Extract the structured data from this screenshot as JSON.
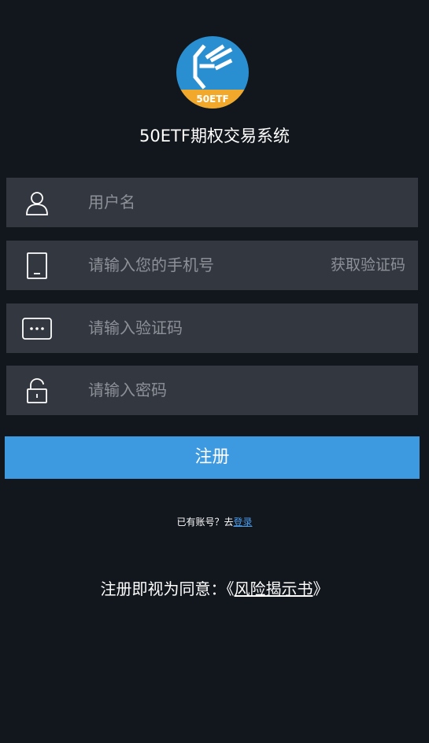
{
  "app": {
    "title": "50ETF期权交易系统",
    "logo_text": "50ETF",
    "logo_colors": {
      "circle": "#2a8fd0",
      "band": "#f2a82a"
    }
  },
  "form": {
    "username": {
      "icon": "user-icon",
      "placeholder": "用户名"
    },
    "phone": {
      "icon": "phone-icon",
      "placeholder": "请输入您的手机号",
      "get_code_label": "获取验证码"
    },
    "code": {
      "icon": "message-dots-icon",
      "placeholder": "请输入验证码"
    },
    "password": {
      "icon": "lock-icon",
      "placeholder": "请输入密码"
    },
    "submit_label": "注册"
  },
  "footer": {
    "have_account_text": "已有账号？去",
    "login_link": "登录",
    "agree_prefix": "注册即视为同意：《",
    "agree_doc": "风险揭示书",
    "agree_suffix": "》"
  },
  "colors": {
    "background": "#12161d",
    "field_bg": "#333740",
    "placeholder": "#8d9097",
    "button": "#3d99e0",
    "link": "#4a9be8"
  }
}
